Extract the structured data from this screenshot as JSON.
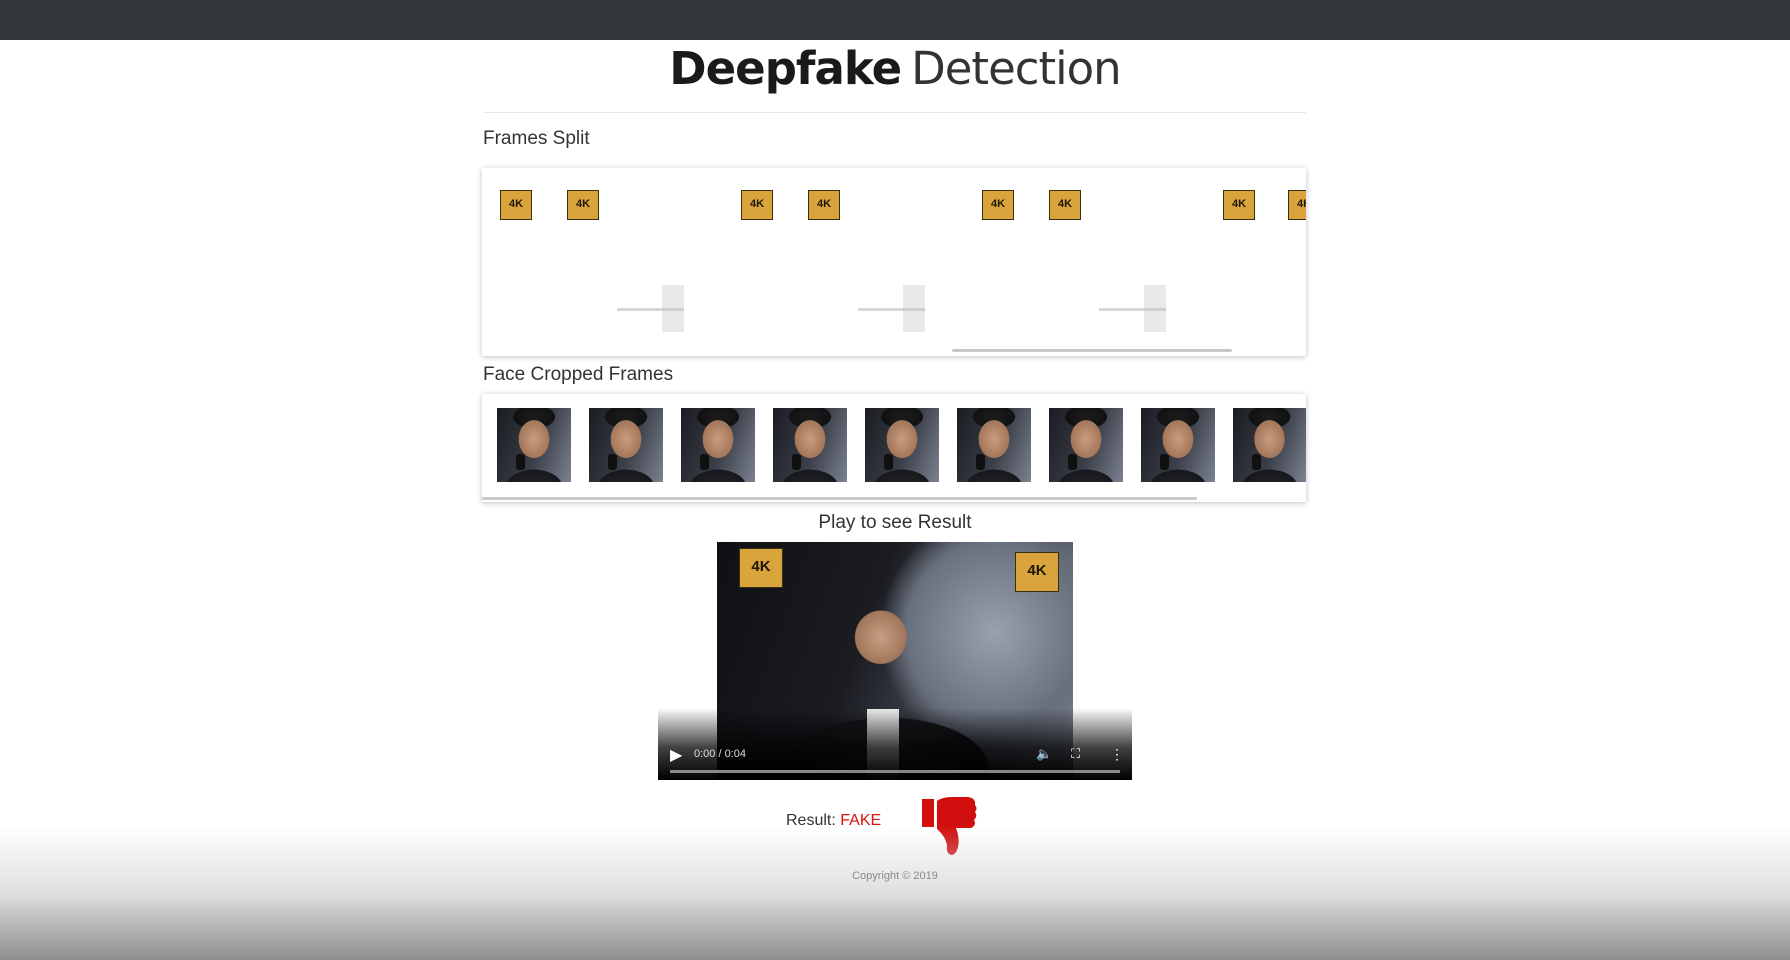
{
  "header": {
    "title_bold": "Deepfake",
    "title_light": "Detection"
  },
  "frames_split": {
    "label": "Frames Split",
    "badge_text": "4K"
  },
  "face_cropped": {
    "label": "Face Cropped Frames"
  },
  "player": {
    "label": "Play to see Result",
    "time": "0:00 / 0:04",
    "badge_text": "4K"
  },
  "result": {
    "label": "Result:",
    "value": "FAKE",
    "value_color": "#dd1111",
    "icon": "thumbs-down-icon"
  },
  "footer": {
    "copyright": "Copyright © 2019"
  },
  "colors": {
    "topbar": "#33373c",
    "background": "#ffffff"
  }
}
